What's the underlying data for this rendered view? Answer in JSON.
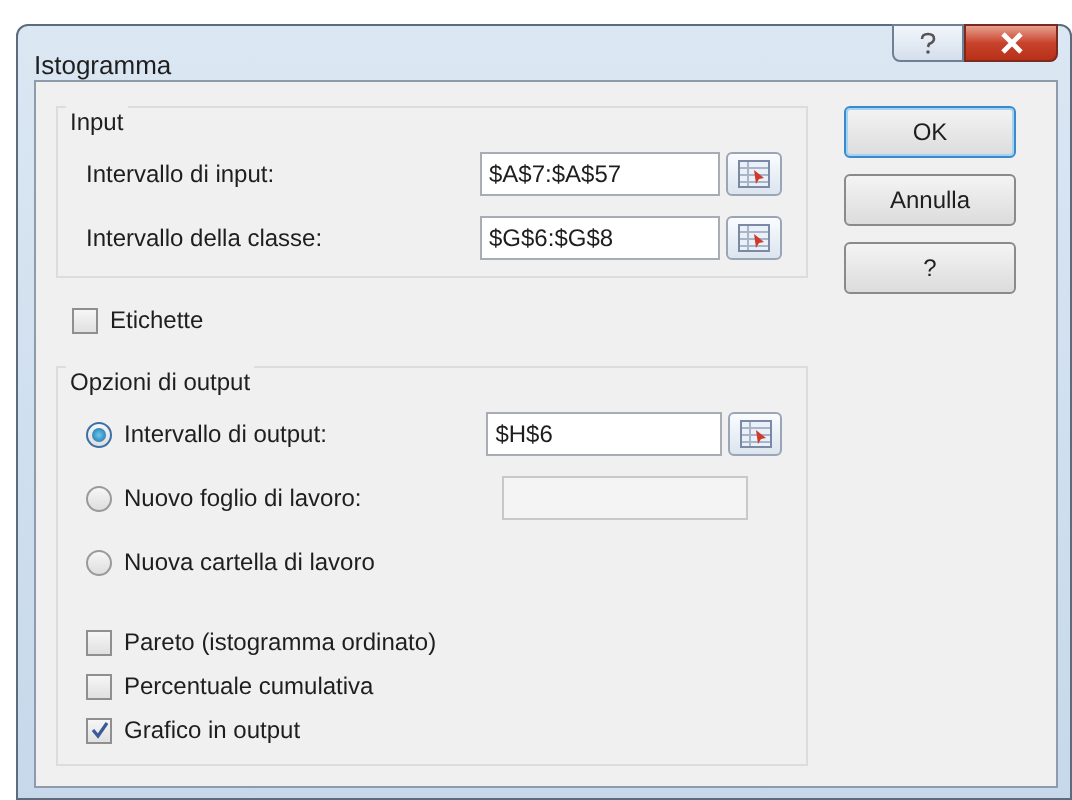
{
  "window": {
    "title": "Istogramma"
  },
  "input_group": {
    "title": "Input",
    "rows": [
      {
        "label": "Intervallo di input:",
        "value": "$A$7:$A$57"
      },
      {
        "label": "Intervallo della classe:",
        "value": "$G$6:$G$8"
      }
    ]
  },
  "labels_checkbox": {
    "label": "Etichette",
    "checked": false
  },
  "output_group": {
    "title": "Opzioni di output",
    "options": [
      {
        "label": "Intervallo di output:",
        "selected": true,
        "field": {
          "value": "$H$6",
          "disabled": false
        }
      },
      {
        "label": "Nuovo foglio di lavoro:",
        "selected": false,
        "field": {
          "disabled": true
        }
      },
      {
        "label": "Nuova cartella di lavoro",
        "selected": false
      }
    ],
    "checkboxes": [
      {
        "label": "Pareto (istogramma ordinato)",
        "checked": false
      },
      {
        "label": "Percentuale cumulativa",
        "checked": false
      },
      {
        "label": "Grafico in output",
        "checked": true
      }
    ]
  },
  "buttons": [
    {
      "label": "OK",
      "default": true
    },
    {
      "label": "Annulla",
      "default": false
    },
    {
      "label": "?",
      "default": false
    }
  ]
}
